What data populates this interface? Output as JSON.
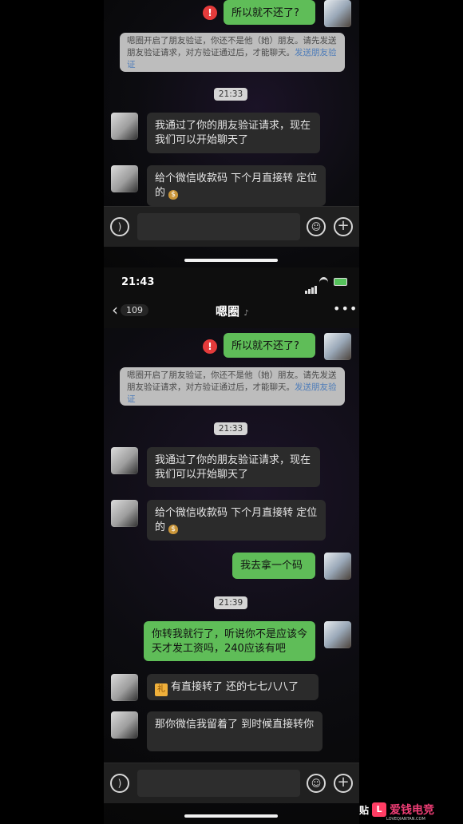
{
  "top_panel": {
    "sent_message_1": "所以就不还了?",
    "system_notice_main": "嗯圈开启了朋友验证，你还不是他（她）朋友。请先发送朋友验证请求，对方验证通过后，才能聊天。",
    "system_notice_link": "发送朋友验证",
    "time_1": "21:33",
    "received_message_1": "我通过了你的朋友验证请求，现在我们可以开始聊天了",
    "received_message_2": "给个微信收款码 下个月直接转 定位的"
  },
  "bottom_panel": {
    "status_time": "21:43",
    "battery": "",
    "back_count": "109",
    "chat_title": "嗯圈",
    "sent_message_1": "所以就不还了?",
    "system_notice_main": "嗯圈开启了朋友验证，你还不是他（她）朋友。请先发送朋友验证请求，对方验证通过后，才能聊天。",
    "system_notice_link": "发送朋友验证",
    "time_1": "21:33",
    "received_message_1": "我通过了你的朋友验证请求，现在我们可以开始聊天了",
    "received_message_2": "给个微信收款码 下个月直接转 定位的",
    "sent_message_2": "我去拿一个码",
    "time_2": "21:39",
    "sent_message_3": "你转我就行了，听说你不是应该今天才发工资吗，240应该有吧",
    "received_message_3": "有直接转了 还的七七八八了",
    "received_message_4": "那你微信我留着了 到时候直接转你"
  },
  "watermark": {
    "paste_text": "贴",
    "brand_text": "爱钱电竞",
    "brand_sub": "LOVEQIANTAN.COM"
  },
  "icons": {
    "warning": "exclamation-icon",
    "voice": "voice-icon",
    "emoji": "emoji-icon",
    "plus": "plus-icon",
    "back": "chevron-left-icon",
    "more": "more-icon",
    "mute": "bell-icon"
  }
}
